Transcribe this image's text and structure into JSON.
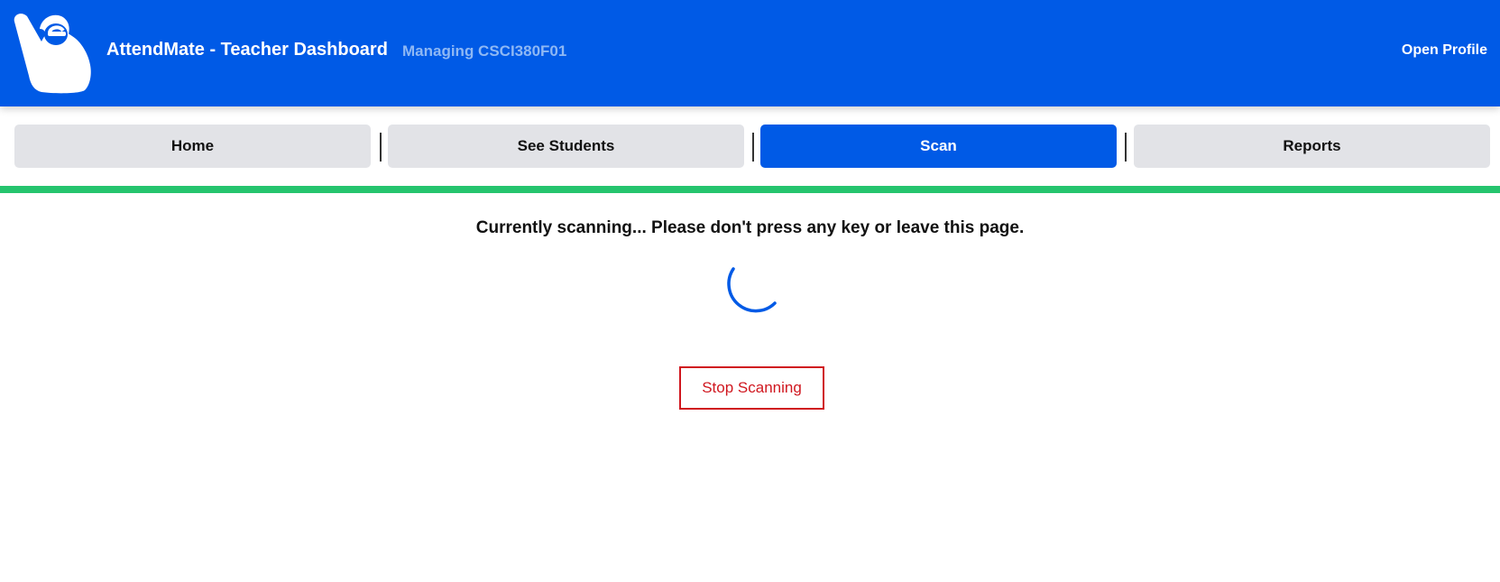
{
  "header": {
    "logo_icon": "raised-hand-logo-icon",
    "title": "AttendMate - Teacher Dashboard",
    "course": "Managing CSCI380F01",
    "profile_link": "Open Profile",
    "background_color": "#005ae6"
  },
  "nav": {
    "tabs": [
      {
        "label": "Home",
        "active": false
      },
      {
        "label": "See Students",
        "active": false
      },
      {
        "label": "Scan",
        "active": true
      },
      {
        "label": "Reports",
        "active": false
      }
    ],
    "active_color": "#005ae6"
  },
  "scan": {
    "status_message": "Currently scanning... Please don't press any key or leave this page.",
    "spinner_icon": "loading-spinner-icon",
    "stop_label": "Stop Scanning",
    "stop_color": "#d0171f",
    "progress_color": "#25c46e"
  }
}
